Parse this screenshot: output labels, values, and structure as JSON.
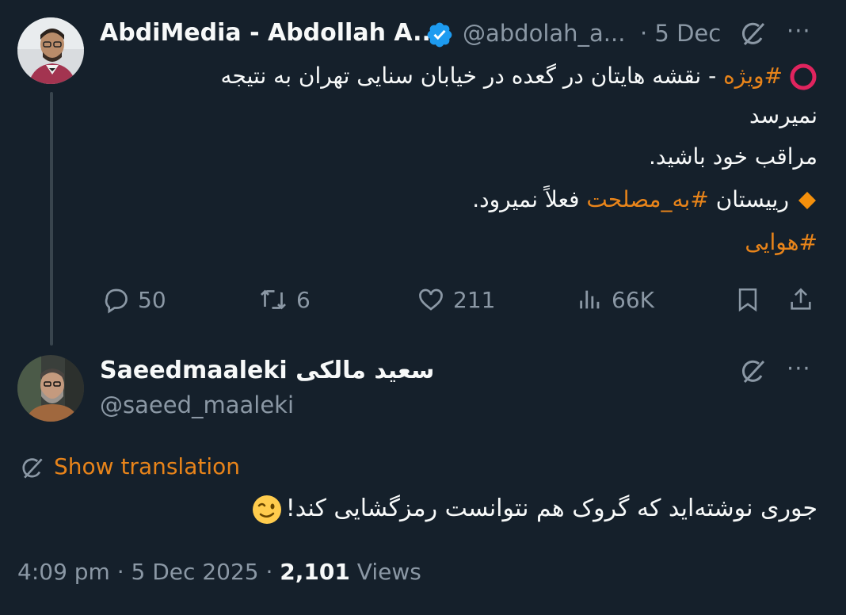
{
  "tweet1": {
    "author_name": "AbdiMedia - Abdollah A...",
    "handle": "@abdolah_a...",
    "date": "· 5 Dec",
    "more": "···",
    "line1_hashtag": "#ویژه",
    "line1_text": " - نقشه هایتان در گعده در خیابان سنایی تهران به نتیجه",
    "line2": "نمیرسد",
    "line3": "مراقب خود باشید.",
    "line4_pre": "رییستان ",
    "line4_hashtag": "#به_مصلحت",
    "line4_post": " فعلاً نمیرود.",
    "line5_hashtag": "#هوایی",
    "stats": {
      "replies": "50",
      "reposts": "6",
      "likes": "211",
      "views": "66K"
    }
  },
  "tweet2": {
    "author_name": "Saeedmaaleki سعید مالکی",
    "handle": "@saeed_maaleki",
    "more": "···",
    "show_translation": "Show translation",
    "text": "جوری نوشته‌اید که گروک هم نتوانست رمزگشایی کند!",
    "time": "4:09 pm · 5 Dec 2025 · ",
    "views_count": "2,101",
    "views_label": " Views"
  },
  "colors": {
    "background": "#15202b",
    "text": "#f7f9f9",
    "muted": "#8b98a5",
    "hashtag": "#e8841a",
    "verified": "#1d9bf0"
  }
}
